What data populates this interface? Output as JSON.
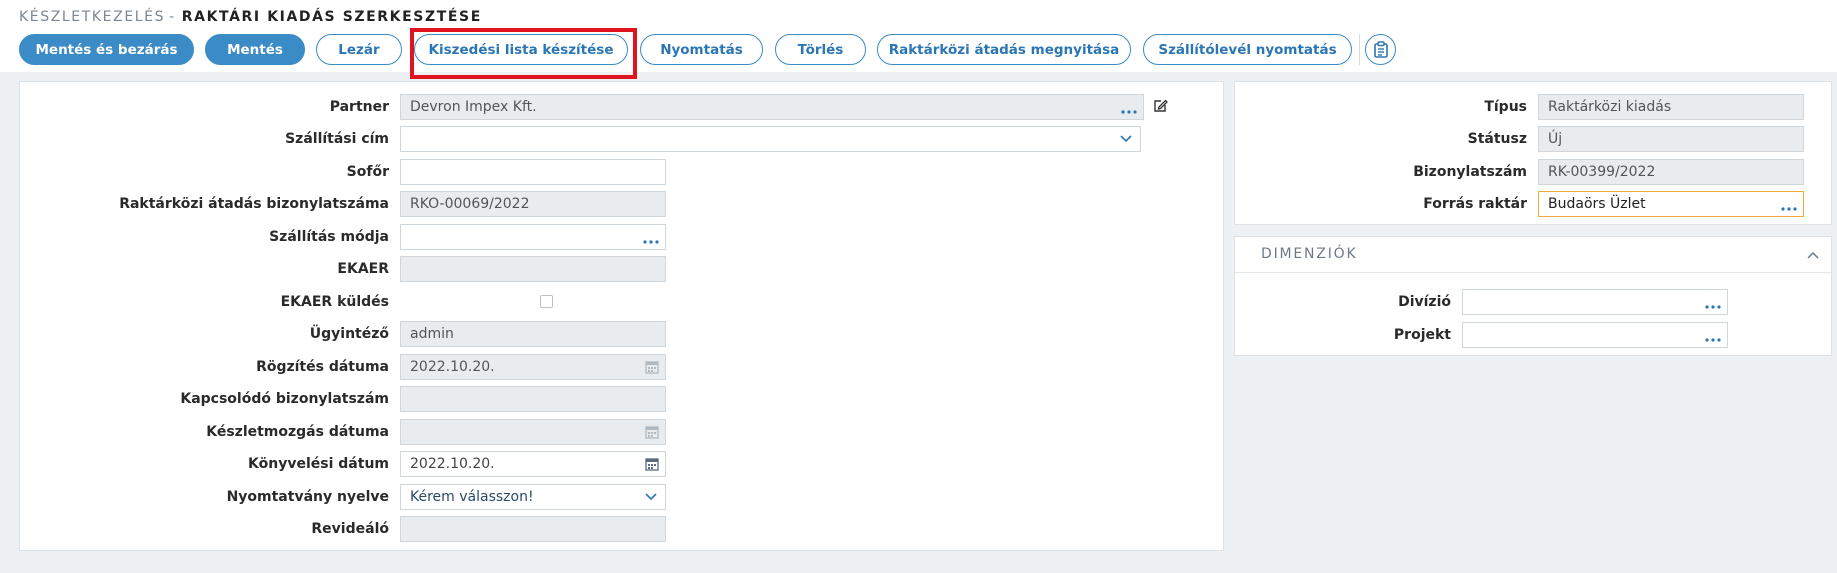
{
  "header": {
    "breadcrumb": "Készletkezelés",
    "separator": "-",
    "page_title": "Raktári kiadás szerkesztése"
  },
  "toolbar": {
    "save_close": "Mentés és bezárás",
    "save": "Mentés",
    "close": "Lezár",
    "picking_list": "Kiszedési lista készítése",
    "print": "Nyomtatás",
    "delete": "Törlés",
    "open_transfer": "Raktárközi átadás megnyitása",
    "print_delivery_note": "Szállítólevél nyomtatás",
    "clipboard_icon": "clipboard-icon"
  },
  "form": {
    "partner": {
      "label": "Partner",
      "value": "Devron Impex Kft."
    },
    "shipping_address": {
      "label": "Szállítási cím",
      "value": ""
    },
    "driver": {
      "label": "Sofőr",
      "value": ""
    },
    "transfer_doc_number": {
      "label": "Raktárközi átadás bizonylatszáma",
      "value": "RKO-00069/2022"
    },
    "shipping_method": {
      "label": "Szállítás módja",
      "value": ""
    },
    "ekaer": {
      "label": "EKAER",
      "value": ""
    },
    "ekaer_send": {
      "label": "EKAER küldés",
      "checked": false
    },
    "clerk": {
      "label": "Ügyintéző",
      "value": "admin"
    },
    "record_date": {
      "label": "Rögzítés dátuma",
      "value": "2022.10.20."
    },
    "related_doc": {
      "label": "Kapcsolódó bizonylatszám",
      "value": ""
    },
    "movement_date": {
      "label": "Készletmozgás dátuma",
      "value": ""
    },
    "posting_date": {
      "label": "Könyvelési dátum",
      "value": "2022.10.20."
    },
    "print_language": {
      "label": "Nyomtatvány nyelve",
      "value": "Kérem válasszon!"
    },
    "reviewer": {
      "label": "Revideáló",
      "value": ""
    }
  },
  "info": {
    "type": {
      "label": "Típus",
      "value": "Raktárközi kiadás"
    },
    "status": {
      "label": "Státusz",
      "value": "Új"
    },
    "doc_number": {
      "label": "Bizonylatszám",
      "value": "RK-00399/2022"
    },
    "source_warehouse": {
      "label": "Forrás raktár",
      "value": "Budaörs Üzlet"
    }
  },
  "dimensions": {
    "title": "Dimenziók",
    "division": {
      "label": "Divízió",
      "value": ""
    },
    "project": {
      "label": "Projekt",
      "value": ""
    }
  },
  "colors": {
    "accent": "#3b8bc6",
    "highlight": "#e0141e",
    "focus_border": "#f0a93c",
    "background": "#eef1f4"
  }
}
